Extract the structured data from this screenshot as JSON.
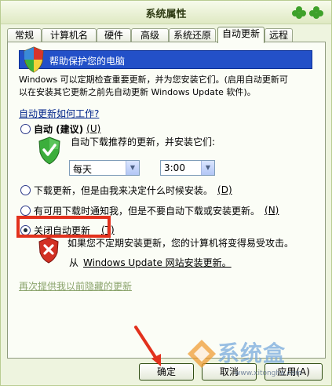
{
  "window": {
    "title": "系统属性"
  },
  "tabs": [
    "常规",
    "计算机名",
    "硬件",
    "高级",
    "系统还原",
    "自动更新",
    "远程"
  ],
  "active_tab": "自动更新",
  "banner": {
    "text": "帮助保护您的电脑"
  },
  "description": {
    "line1": "Windows 可以定期检查重要更新，并为您安装它们。(启用自动更新可",
    "line2": "以在安装其它更新之前先自动更新 Windows Update 软件)。"
  },
  "how_link": "自动更新如何工作?",
  "options": {
    "auto": {
      "label": "自动 (建议)",
      "key": "(U)",
      "sub": "自动下载推荐的更新，并安装它们:",
      "day": "每天",
      "time": "3:00"
    },
    "download": {
      "label": "下载更新，但是由我来决定什么时候安装。",
      "key": "(D)"
    },
    "notify": {
      "label": "有可用下载时通知我，但是不要自动下载或安装更新。",
      "key": "(N)"
    },
    "off": {
      "label": "关闭自动更新",
      "key": "(T)",
      "warning": "如果您不定期安装更新，您的计算机将变得易受攻击。",
      "from": "从",
      "from_link": "Windows Update 网站安装更新。"
    }
  },
  "hidden_updates_link": "再次提供我以前隐藏的更新",
  "buttons": {
    "ok": "确定",
    "cancel": "取消",
    "apply": "应用(A)"
  },
  "watermark": {
    "text": "系统盒",
    "url": "www.xitonghe.com"
  },
  "colors": {
    "banner": "#2350c8",
    "highlight": "#e2311d",
    "window_bg": "#eef4df"
  }
}
